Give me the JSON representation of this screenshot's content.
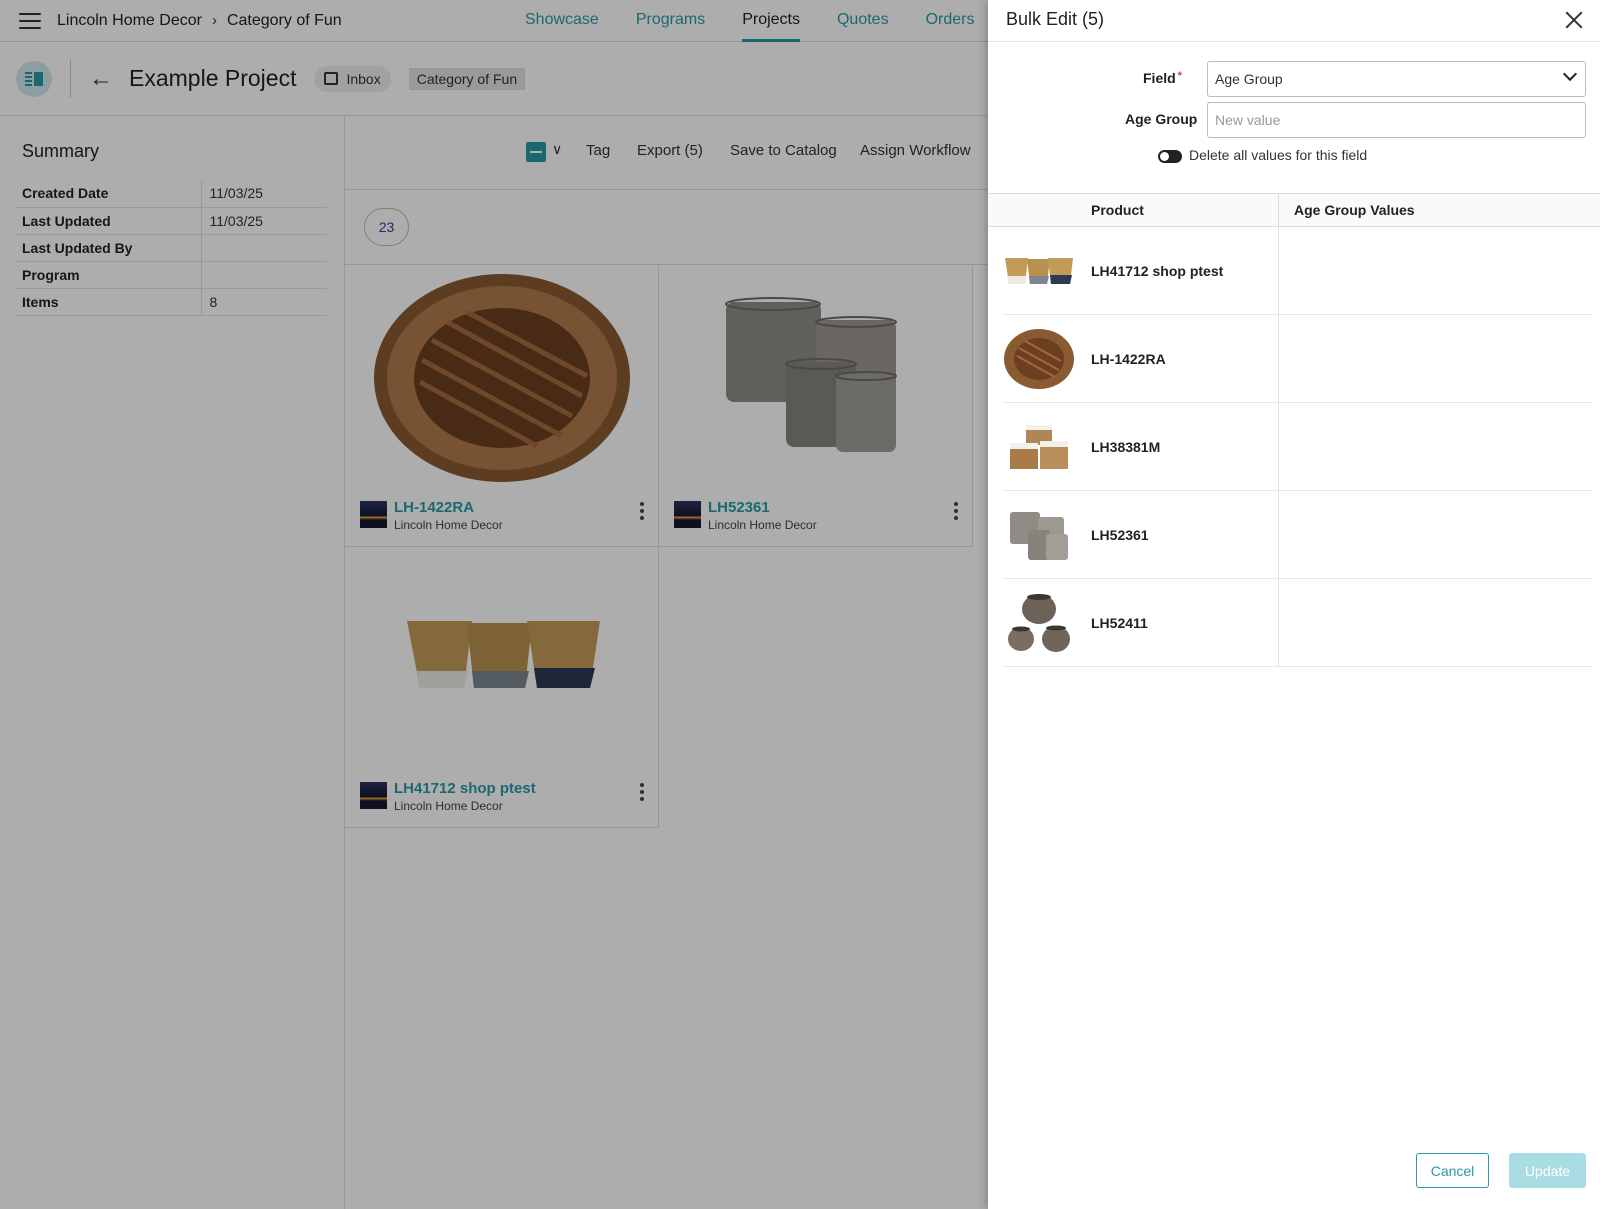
{
  "header": {
    "breadcrumb": [
      "Lincoln Home Decor",
      "Category of Fun"
    ],
    "nav": [
      {
        "label": "Showcase",
        "active": false
      },
      {
        "label": "Programs",
        "active": false
      },
      {
        "label": "Projects",
        "active": true
      },
      {
        "label": "Quotes",
        "active": false
      },
      {
        "label": "Orders",
        "active": false
      }
    ]
  },
  "project": {
    "title": "Example Project",
    "inbox_chip": "Inbox",
    "category_chip": "Category of Fun"
  },
  "summary": {
    "title": "Summary",
    "rows": [
      {
        "key": "Created Date",
        "value": "11/03/25"
      },
      {
        "key": "Last Updated",
        "value": "11/03/25"
      },
      {
        "key": "Last Updated By",
        "value": ""
      },
      {
        "key": "Program",
        "value": ""
      },
      {
        "key": "Items",
        "value": "8"
      }
    ]
  },
  "toolbar": {
    "tag": "Tag",
    "export": "Export (5)",
    "save_catalog": "Save to Catalog",
    "assign_workflow": "Assign Workflow"
  },
  "count_pill": "23",
  "cards": [
    {
      "sku": "LH-1422RA",
      "brand": "Lincoln Home Decor",
      "image": "round-rattan-charger"
    },
    {
      "sku": "LH52361",
      "brand": "Lincoln Home Decor",
      "image": "grey-wicker-basket-set"
    },
    {
      "sku": "LH41712 shop ptest",
      "brand": "Lincoln Home Decor",
      "image": "seagrass-basket-trio"
    }
  ],
  "drawer": {
    "title": "Bulk Edit (5)",
    "field_label": "Field",
    "field_value": "Age Group",
    "value_label": "Age Group",
    "value_placeholder": "New value",
    "delete_toggle_label": "Delete all values for this field",
    "table": {
      "col_product": "Product",
      "col_values": "Age Group Values",
      "rows": [
        {
          "name": "LH41712 shop ptest",
          "image": "seagrass-basket-trio",
          "value": ""
        },
        {
          "name": "LH-1422RA",
          "image": "round-rattan-charger",
          "value": ""
        },
        {
          "name": "LH38381M",
          "image": "storage-basket-set",
          "value": ""
        },
        {
          "name": "LH52361",
          "image": "grey-wicker-basket-set",
          "value": ""
        },
        {
          "name": "LH52411",
          "image": "round-wicker-basket-set",
          "value": ""
        }
      ]
    },
    "cancel_label": "Cancel",
    "update_label": "Update"
  },
  "colors": {
    "accent": "#2a9aa6",
    "update_disabled": "#a9dde3"
  }
}
